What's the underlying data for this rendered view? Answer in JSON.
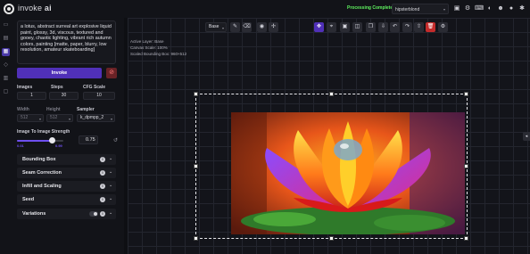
{
  "app": {
    "logo_text": "invoke",
    "logo_text_bold": "ai"
  },
  "header": {
    "status": "Processing Complete",
    "model": "hipsterblond",
    "model_caret": "▾",
    "icons": [
      "image-icon",
      "settings-icon",
      "keyboard-icon",
      "palette-icon",
      "discord-icon",
      "github-icon",
      "bug-icon"
    ]
  },
  "rail": [
    "text-to-image-icon",
    "image-to-image-icon",
    "unified-canvas-icon",
    "nodes-icon",
    "outpainting-icon",
    "training-icon"
  ],
  "options": {
    "prompt": "a lotus, abstract surreal art explosive liquid paint, glossy, 3d, viscous, textured and gooey, chaotic lighting, vibrant rich autumn colors, painting [matte, paper, blurry, low resolution, amateur skateboarding]",
    "invoke_label": "Invoke",
    "cancel_icon": "⊘",
    "images_label": "Images",
    "images_value": "1",
    "steps_label": "Steps",
    "steps_value": "30",
    "cfg_label": "CFG Scale",
    "cfg_value": "10",
    "width_label": "Width",
    "width_value": "512",
    "height_label": "Height",
    "height_value": "512",
    "sampler_label": "Sampler",
    "sampler_value": "k_dpmpp_2",
    "strength_label": "Image To Image Strength",
    "strength_value": "0.75",
    "strength_fraction": 0.75,
    "strength_min": "0.01",
    "strength_max": "0.99",
    "accordions": [
      {
        "label": "Bounding Box"
      },
      {
        "label": "Seam Correction"
      },
      {
        "label": "Infill and Scaling"
      },
      {
        "label": "Seed"
      },
      {
        "label": "Variations"
      }
    ]
  },
  "canvas": {
    "layer": "Base",
    "info": [
      "Active Layer: Base",
      "Canvas Scale: 100%",
      "Scaled Bounding Box: 960×512"
    ],
    "tools": [
      "brush-icon",
      "eraser-icon",
      "color-picker-icon",
      "eyedropper-icon",
      "move-icon",
      "reset-view-icon",
      "merge-icon",
      "save-icon",
      "copy-icon",
      "download-icon",
      "undo-icon",
      "redo-icon",
      "upload-icon",
      "delete-icon",
      "settings-icon"
    ]
  }
}
